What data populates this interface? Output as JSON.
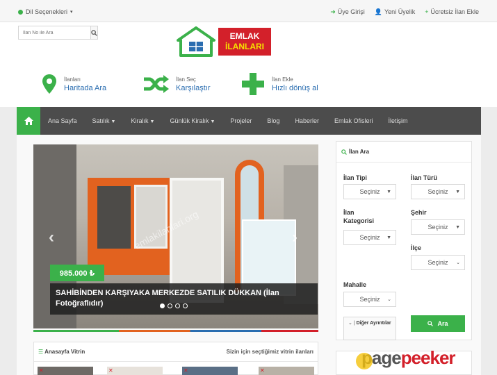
{
  "topbar": {
    "language": "Dil Seçenekleri",
    "login": "Üye Girişi",
    "register": "Yeni Üyelik",
    "add_listing": "Ücretsiz İlan Ekle"
  },
  "header": {
    "search_placeholder": "İlan No ile Ara",
    "logo_line1": "EMLAK",
    "logo_line2": "İLANLARI",
    "features": [
      {
        "small": "İlanları",
        "big": "Haritada Ara",
        "icon": "map-pin-icon"
      },
      {
        "small": "İlan Seç",
        "big": "Karşılaştır",
        "icon": "shuffle-icon"
      },
      {
        "small": "İlan Ekle",
        "big": "Hızlı dönüş al",
        "icon": "plus-icon"
      }
    ]
  },
  "nav": {
    "items": [
      "Ana Sayfa",
      "Satılık",
      "Kiralık",
      "Günlük Kiralık",
      "Projeler",
      "Blog",
      "Haberler",
      "Emlak Ofisleri",
      "İletişim"
    ]
  },
  "slider": {
    "watermark": "emlakilanlari.org",
    "price": "985.000 ₺",
    "title": "SAHİBİNDEN KARŞIYAKA MERKEZDE SATILIK DÜKKAN (İlan Fotoğraflıdır)",
    "current_slide": 1,
    "total_slides": 4
  },
  "vitrin": {
    "title": "Anasayfa Vitrin",
    "subtitle": "Sizin için seçtiğimiz vitrin ilanları"
  },
  "search_panel": {
    "title": "İlan Ara",
    "ilan_tipi_label": "İlan Tipi",
    "ilan_turu_label": "İlan Türü",
    "kategori_label": "İlan Kategorisi",
    "sehir_label": "Şehir",
    "ilce_label": "İlçe",
    "mahalle_label": "Mahalle",
    "select_value": "Seçiniz",
    "more_label": "Diğer Ayrıntılar",
    "search_button": "Ara"
  },
  "watermark": {
    "part1": "page",
    "part2": "peeker"
  },
  "colors": {
    "green": "#3bb14a",
    "nav_bg": "#4c4c4c",
    "blue_link": "#2a6db0",
    "red": "#d3202a",
    "orange": "#e2621f"
  }
}
